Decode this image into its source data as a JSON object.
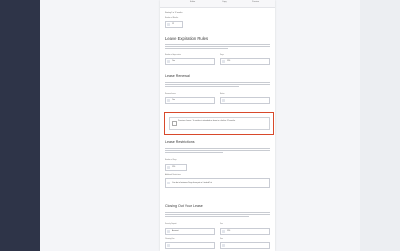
{
  "tabs": [
    "Editor",
    "Copy",
    "Preview"
  ],
  "top": {
    "heading": "Starting 1 to 12 months",
    "label": "Number of Months",
    "value": "12"
  },
  "leave_expiration": {
    "title": "Leave Expiration Rules",
    "left_label": "Number of days notice",
    "left_value": "Yes",
    "right_label": "Days",
    "right_value": "120"
  },
  "lease_renewal": {
    "title": "Lease Renewal",
    "left_label": "Renewal terms",
    "left_value": "Yes",
    "right_label": "Notice"
  },
  "highlight": {
    "text": "Premises Lease - To confirm is intended as lease to a further 12 months"
  },
  "lease_restrictions": {
    "title": "Lease Restrictions",
    "label": "Number of Days",
    "value": "120",
    "label2": "Additional Restrictions",
    "text": "Can be in between Days from pet or Limited 1st"
  },
  "closing": {
    "title": "Closing Out Your Lease",
    "left_label": "Security Deposit",
    "left_value": "Amount",
    "right_label": "Fee",
    "right_value": "120",
    "bottom_left_label": "Cleaning Fee",
    "bottom_right_label": "Due"
  },
  "colors": {
    "highlight": "#d8492b",
    "sidebar": "#2e3448"
  }
}
